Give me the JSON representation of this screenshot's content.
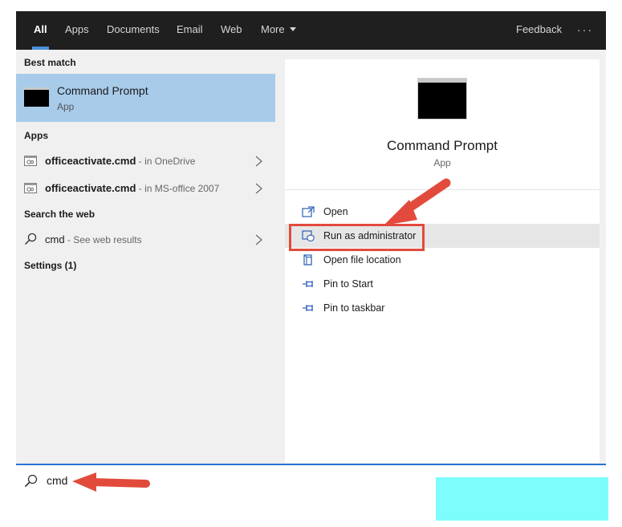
{
  "tabs": [
    {
      "label": "All",
      "active": true
    },
    {
      "label": "Apps"
    },
    {
      "label": "Documents"
    },
    {
      "label": "Email"
    },
    {
      "label": "Web"
    },
    {
      "label": "More"
    }
  ],
  "header": {
    "feedback_label": "Feedback",
    "more_options": "···"
  },
  "left": {
    "best_match_heading": "Best match",
    "best_match": {
      "title": "Command Prompt",
      "subtitle": "App"
    },
    "apps_heading": "Apps",
    "apps": [
      {
        "name": "officeactivate.cmd",
        "location": " - in OneDrive"
      },
      {
        "name": "officeactivate.cmd",
        "location": " - in MS-office 2007"
      }
    ],
    "web_heading": "Search the web",
    "web_result": {
      "query": "cmd",
      "suffix": " - See web results"
    },
    "settings_heading": "Settings (1)"
  },
  "detail": {
    "title": "Command Prompt",
    "subtitle": "App",
    "actions": [
      {
        "label": "Open",
        "icon": "open-icon"
      },
      {
        "label": "Run as administrator",
        "icon": "shield-icon",
        "highlighted": true
      },
      {
        "label": "Open file location",
        "icon": "file-location-icon"
      },
      {
        "label": "Pin to Start",
        "icon": "pin-icon"
      },
      {
        "label": "Pin to taskbar",
        "icon": "pin-icon"
      }
    ]
  },
  "search": {
    "value": "cmd"
  },
  "colors": {
    "topbar": "#1f1f1f",
    "selected": "#a8cbea",
    "annotation": "#e24b3c",
    "accent": "#2b6fcf",
    "cyan_block": "#7dfdfc"
  }
}
